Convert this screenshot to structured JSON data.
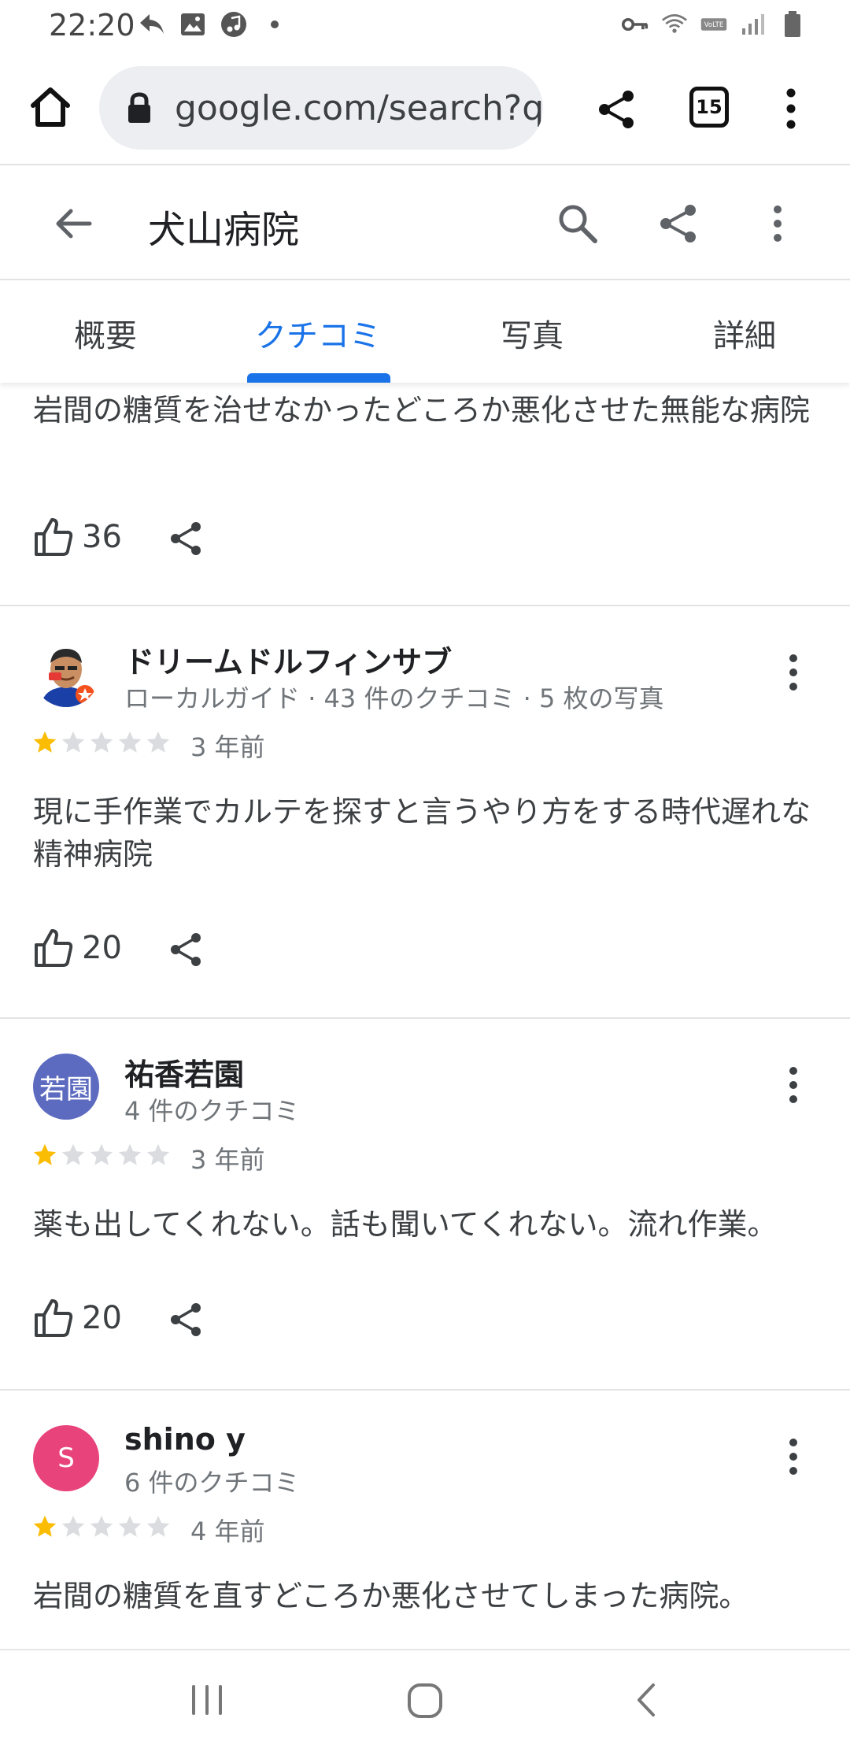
{
  "status": {
    "time": "22:20"
  },
  "browser": {
    "url": "google.com/search?q",
    "tab_count": "15"
  },
  "place": {
    "title": "犬山病院"
  },
  "tabs": [
    {
      "label": "概要"
    },
    {
      "label": "クチコミ"
    },
    {
      "label": "写真"
    },
    {
      "label": "詳細"
    }
  ],
  "reviews": [
    {
      "text": "岩間の糖質を治せなかったどころか悪化させた無能な病院",
      "likes": "36"
    },
    {
      "name": "ドリームドルフィンサブ",
      "meta": "ローカルガイド · 43 件のクチコミ · 5 枚の写真",
      "rating": 1,
      "time": "3 年前",
      "text": "現に手作業でカルテを探すと言うやり方をする時代遅れな精神病院",
      "likes": "20"
    },
    {
      "name": "祐香若園",
      "avatar_text": "若園",
      "meta": "4 件のクチコミ",
      "rating": 1,
      "time": "3 年前",
      "text": "薬も出してくれない。話も聞いてくれない。流れ作業。",
      "likes": "20"
    },
    {
      "name": "shino y",
      "avatar_text": "S",
      "meta": "6 件のクチコミ",
      "rating": 1,
      "time": "4 年前",
      "text": "岩間の糖質を直すどころか悪化させてしまった病院。"
    }
  ],
  "colors": {
    "accent": "#1a73e8",
    "star": "#fbbc04",
    "star_empty": "#dadce0",
    "avatar_purple": "#5c6bc0",
    "avatar_pink": "#e8437a"
  }
}
